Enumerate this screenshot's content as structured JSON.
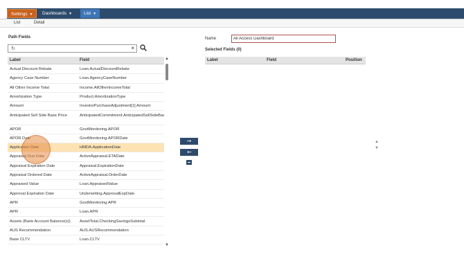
{
  "menubar": {
    "settings_label": "Settings",
    "dashboards_label": "Dashboards",
    "list_label": "List"
  },
  "subnav": {
    "items": [
      "List",
      "Detail"
    ]
  },
  "path_fields": {
    "title": "Path Fields",
    "search_value": "↻",
    "columns": [
      "Label",
      "Field"
    ],
    "rows": [
      {
        "label": "Actual Discount Rebate",
        "field": "Loan.ActualDiscountRebate"
      },
      {
        "label": "Agency Case Number",
        "field": "Loan.AgencyCaseNumber"
      },
      {
        "label": "All Other Income Total",
        "field": "Income.AllOtherIncomeTotal"
      },
      {
        "label": "Amortization Type",
        "field": "Product.AmortizationType"
      },
      {
        "label": "Amount",
        "field": "InvestorPurchaseAdjustment[1].Amount"
      },
      {
        "label": "Anticipated Sell Side Base Price",
        "field": "AnticipatedCommitment.AnticipatedSellSideBasePrice"
      },
      {
        "label": "APOR",
        "field": "GovtMonitoring.APOR"
      },
      {
        "label": "APOR Date",
        "field": "GovtMonitoring.APORDate"
      },
      {
        "label": "Application Date",
        "field": "HMDA.ApplicationDate"
      },
      {
        "label": "Appraisal Due Date",
        "field": "ActiveAppraisal.ETADate"
      },
      {
        "label": "Appraisal Expiration Date",
        "field": "Appraisal.ExpirationDate"
      },
      {
        "label": "Appraisal Ordered Date",
        "field": "ActiveAppraisal.OrderDate"
      },
      {
        "label": "Appraised Value",
        "field": "Loan.AppraisedValue"
      },
      {
        "label": "Approval Expiration Date",
        "field": "Underwriting.ApprovalExpDate"
      },
      {
        "label": "APR",
        "field": "GovtMonitoring.APR"
      },
      {
        "label": "APR",
        "field": "Loan.APR"
      },
      {
        "label": "Assets (Bank Account Balance(s))",
        "field": "AssetTotal.CheckingSavingsSubtotal"
      },
      {
        "label": "AUS Recommendation",
        "field": "AUS.AUSRecommendation"
      },
      {
        "label": "Base CLTV",
        "field": "Loan.CLTV"
      }
    ],
    "selected_row_index": 8
  },
  "transfer": {
    "add_icon": "arrow-right-icon",
    "remove_icon": "arrow-left-icon",
    "remove_all_icon": "minus-icon"
  },
  "dashboard": {
    "name_label": "Name",
    "name_value": "All Access Dashboard",
    "selected_fields_title": "Selected Fields (0)",
    "columns": [
      "Label",
      "Field",
      "Position"
    ]
  },
  "colors": {
    "menubar": "#2d4b6c",
    "settings_tab": "#c9621e",
    "list_tab": "#3d77b8",
    "selected_row": "#fde3b3"
  }
}
